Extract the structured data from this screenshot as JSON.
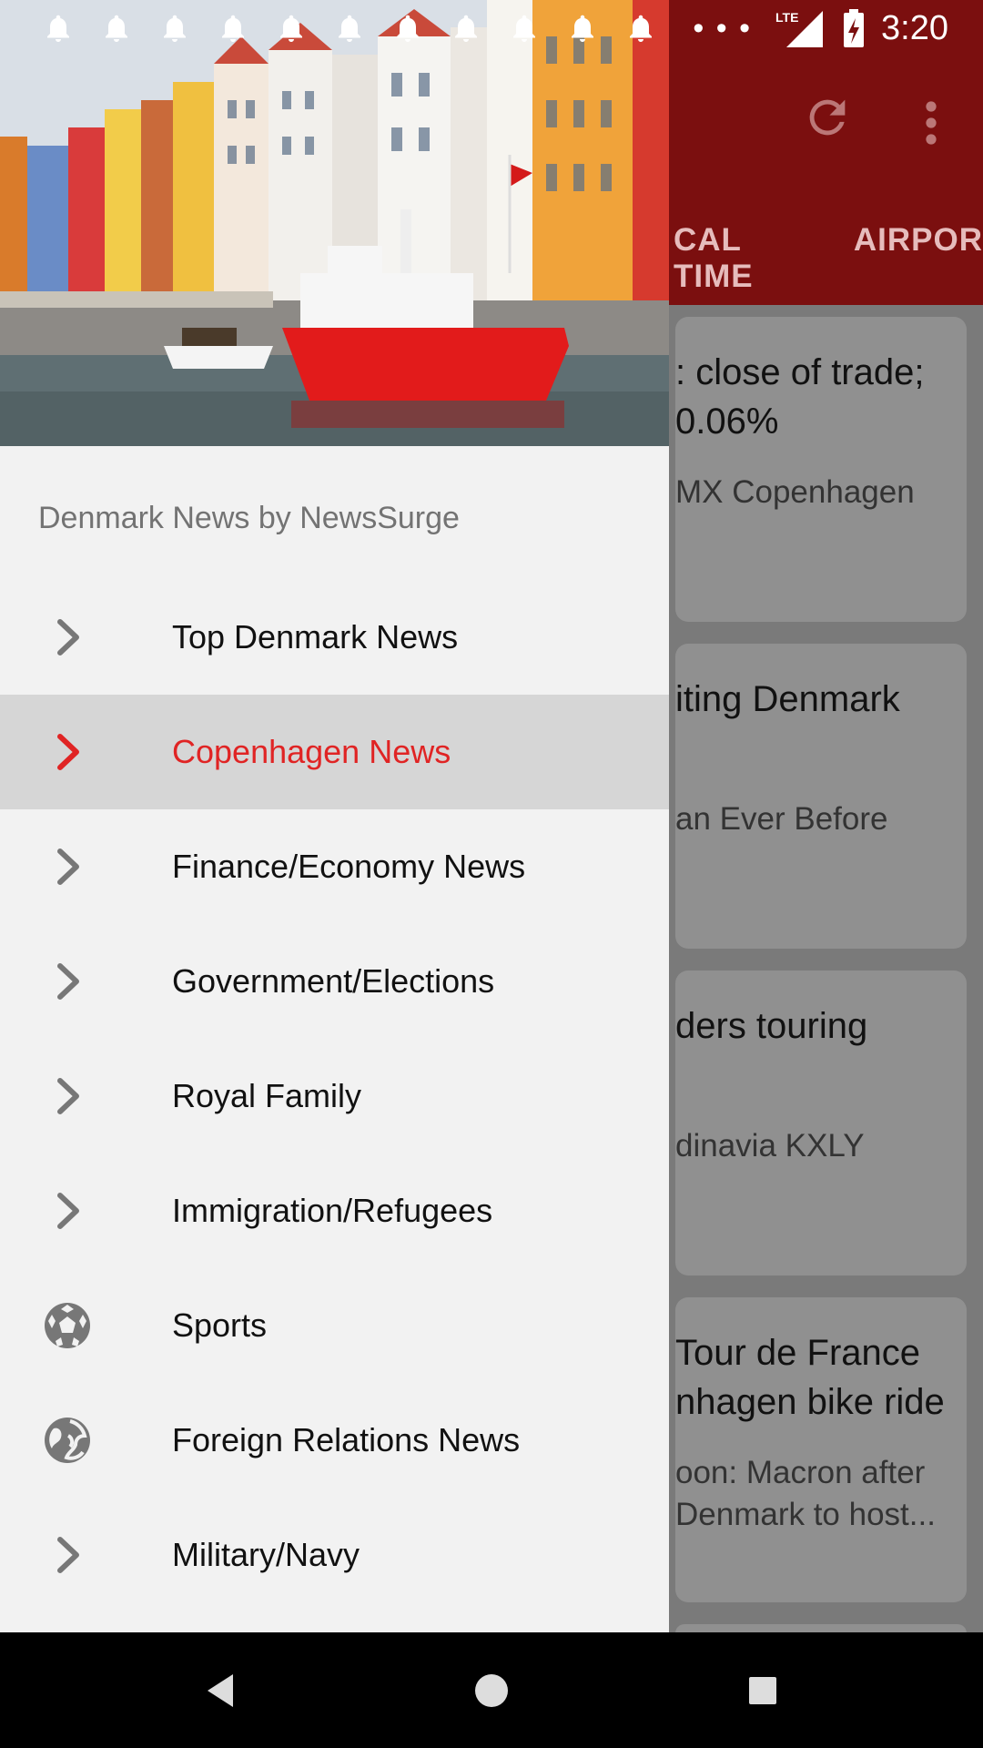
{
  "status": {
    "time": "3:20",
    "network": "LTE",
    "notification_count": 11
  },
  "app": {
    "tabs_visible": [
      "CAL TIME",
      "AIRPOR"
    ],
    "cards": [
      {
        "title": ": close of trade; 0.06%",
        "subtitle": "MX Copenhagen"
      },
      {
        "title": "iting Denmark",
        "subtitle": "an Ever Before"
      },
      {
        "title": "ders touring",
        "subtitle": "dinavia  KXLY"
      },
      {
        "title": "Tour de France nhagen bike ride",
        "subtitle": "oon: Macron after Denmark to host..."
      }
    ]
  },
  "drawer": {
    "header_title": "Denmark News by NewsSurge",
    "items": [
      {
        "label": "Top Denmark News",
        "icon": "chevron-right-icon"
      },
      {
        "label": "Copenhagen News",
        "icon": "chevron-right-icon",
        "active": true
      },
      {
        "label": "Finance/Economy News",
        "icon": "chevron-right-icon"
      },
      {
        "label": "Government/Elections",
        "icon": "chevron-right-icon"
      },
      {
        "label": "Royal Family",
        "icon": "chevron-right-icon"
      },
      {
        "label": "Immigration/Refugees",
        "icon": "chevron-right-icon"
      },
      {
        "label": "Sports",
        "icon": "soccer-ball-icon"
      },
      {
        "label": "Foreign Relations News",
        "icon": "globe-icon"
      },
      {
        "label": "Military/Navy",
        "icon": "chevron-right-icon"
      }
    ]
  },
  "colors": {
    "accent": "#e02424",
    "app_bar": "#7b0f0f",
    "drawer_bg": "#f2f2f2",
    "active_row": "#d6d6d6"
  }
}
